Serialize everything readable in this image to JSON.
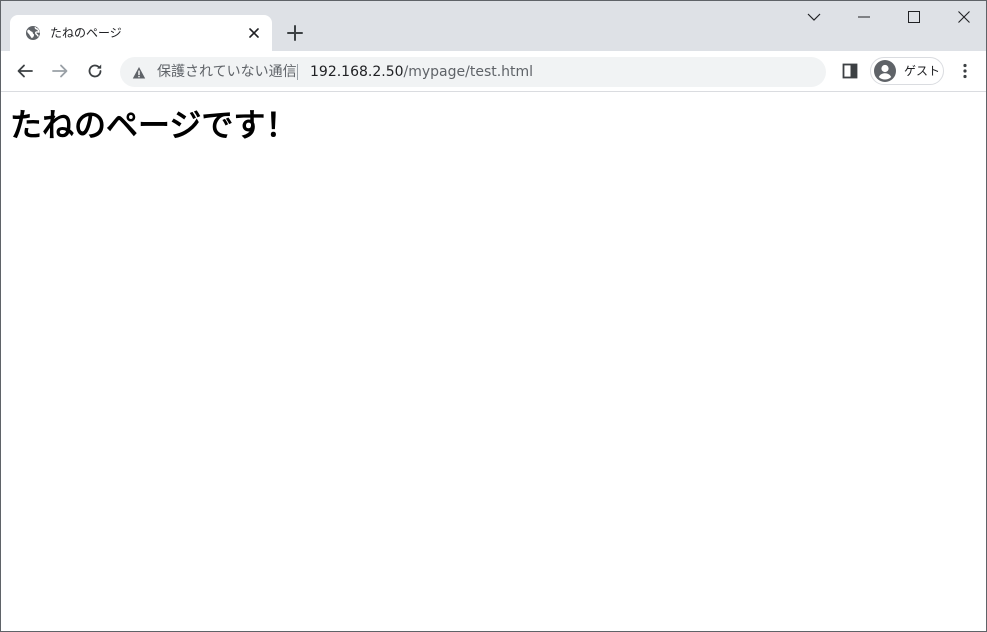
{
  "colors": {
    "tabstrip_bg": "#dee1e6",
    "omnibox_bg": "#f1f3f4",
    "icon_gray": "#5f6368",
    "text_dark": "#202124"
  },
  "tab": {
    "title": "たねのページ",
    "favicon": "globe-icon",
    "close_icon": "close-icon"
  },
  "window_controls": {
    "tab_search_icon": "chevron-down-icon",
    "minimize_icon": "minimize-icon",
    "maximize_icon": "maximize-icon",
    "close_icon": "close-icon"
  },
  "toolbar": {
    "back_icon": "arrow-left-icon",
    "forward_icon": "arrow-right-icon",
    "reload_icon": "reload-icon",
    "security_label": "保護されていない通信",
    "url_host": "192.168.2.50",
    "url_path": "/mypage/test.html",
    "side_panel_icon": "side-panel-icon",
    "profile_label": "ゲスト",
    "menu_icon": "kebab-menu-icon"
  },
  "page": {
    "heading": "たねのページです！"
  }
}
